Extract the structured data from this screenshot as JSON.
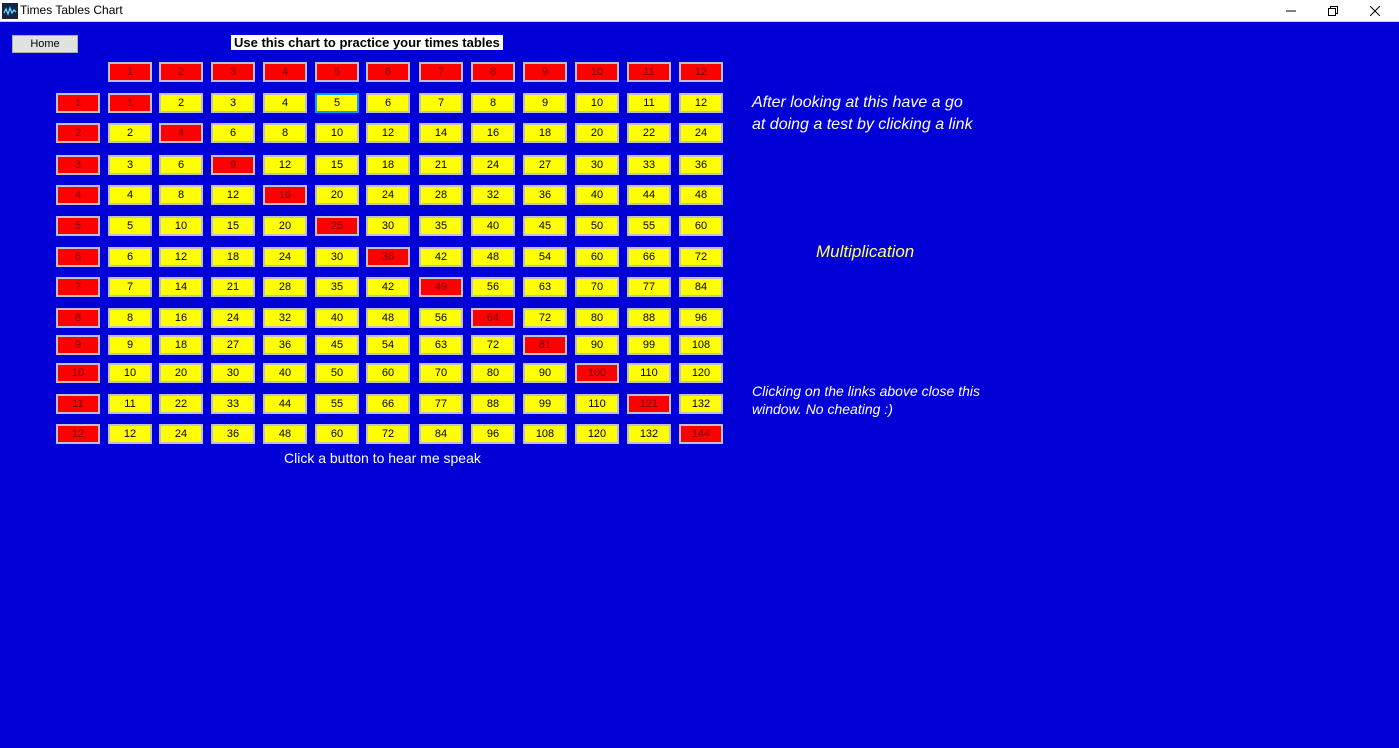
{
  "window": {
    "title": "Times Tables Chart"
  },
  "toolbar": {
    "home_label": "Home"
  },
  "heading": "Use this chart to practice your times tables",
  "hint": "Click a button to hear me speak",
  "side": {
    "intro_line1": "After looking at this have a go",
    "intro_line2": "at doing a test by clicking a link",
    "link_label": "Multiplication",
    "note": "Clicking on the links above close this window. No cheating :)"
  },
  "grid": {
    "size": 12,
    "focused_value": "5",
    "colors": {
      "header": "#ff0000",
      "cell": "#ffff00",
      "background": "#0000d7"
    }
  }
}
